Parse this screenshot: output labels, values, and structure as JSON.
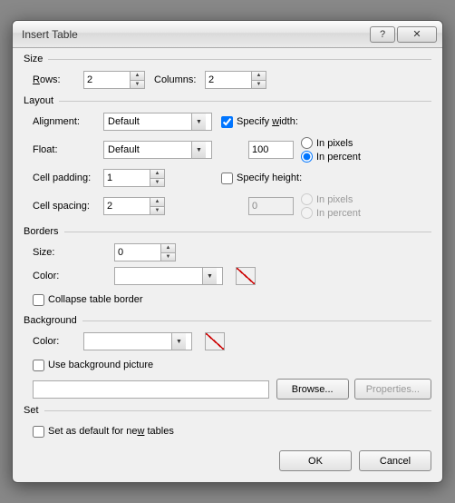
{
  "title": "Insert Table",
  "help_symbol": "?",
  "close_symbol": "✕",
  "groups": {
    "size": {
      "label": "Size",
      "rows_label": "Rows:",
      "rows_value": "2",
      "columns_label": "Columns:",
      "columns_value": "2"
    },
    "layout": {
      "label": "Layout",
      "alignment_label": "Alignment:",
      "alignment_value": "Default",
      "specify_width_label": "Specify width:",
      "float_label": "Float:",
      "float_value": "Default",
      "width_value": "100",
      "width_pixels": "In pixels",
      "width_percent": "In percent",
      "cell_padding_label": "Cell padding:",
      "cell_padding_value": "1",
      "specify_height_label": "Specify height:",
      "cell_spacing_label": "Cell spacing:",
      "cell_spacing_value": "2",
      "height_value": "0",
      "height_pixels": "In pixels",
      "height_percent": "In percent"
    },
    "borders": {
      "label": "Borders",
      "size_label": "Size:",
      "size_value": "0",
      "color_label": "Color:",
      "color_value": "",
      "collapse_label": "Collapse table border"
    },
    "background": {
      "label": "Background",
      "color_label": "Color:",
      "color_value": "",
      "use_pic_label": "Use background picture",
      "path_value": "",
      "browse_label": "Browse...",
      "properties_label": "Properties..."
    },
    "set": {
      "label": "Set",
      "default_label": "Set as default for new tables"
    }
  },
  "buttons": {
    "ok": "OK",
    "cancel": "Cancel"
  }
}
